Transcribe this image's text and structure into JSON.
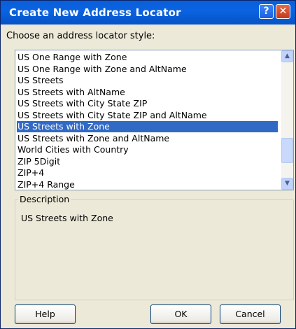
{
  "window": {
    "title": "Create New Address Locator"
  },
  "prompt": "Choose an address locator style:",
  "list": {
    "items": [
      "US One Range with Zone",
      "US One Range with Zone and AltName",
      "US Streets",
      "US Streets with AltName",
      "US Streets with City State ZIP",
      "US Streets with City State ZIP and AltName",
      "US Streets with Zone",
      "US Streets with Zone and AltName",
      "World Cities with Country",
      "ZIP 5Digit",
      "ZIP+4",
      "ZIP+4 Range"
    ],
    "selected_index": 6
  },
  "description": {
    "label": "Description",
    "text": "US Streets with Zone"
  },
  "buttons": {
    "help": "Help",
    "ok": "OK",
    "cancel": "Cancel"
  },
  "colors": {
    "titlebar": "#0553c6",
    "selection": "#316ac5",
    "dialog_bg": "#ece9d8"
  }
}
